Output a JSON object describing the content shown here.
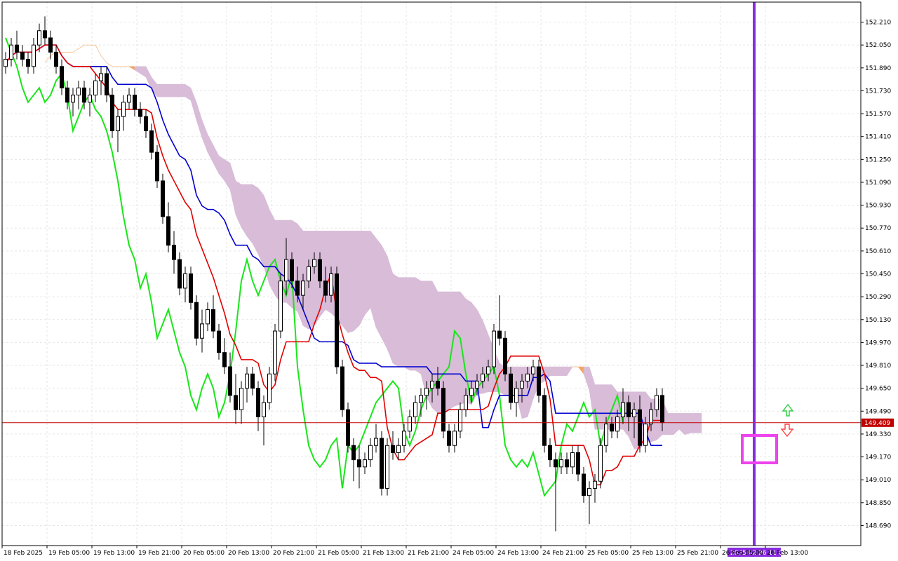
{
  "chart_data": {
    "type": "candlestick",
    "indicator": "Ichimoku Kinko Hyo",
    "grid": true,
    "y_range": [
      148.55,
      152.35
    ],
    "y_ticks": [
      "152.210",
      "152.050",
      "151.890",
      "151.730",
      "151.570",
      "151.410",
      "151.250",
      "151.090",
      "150.930",
      "150.770",
      "150.610",
      "150.450",
      "150.290",
      "150.130",
      "149.970",
      "149.810",
      "149.650",
      "149.490",
      "149.330",
      "149.170",
      "149.010",
      "148.850",
      "148.690"
    ],
    "x_ticks": [
      "18 Feb 2025",
      "19 Feb 05:00",
      "19 Feb 13:00",
      "19 Feb 21:00",
      "20 Feb 05:00",
      "20 Feb 13:00",
      "20 Feb 21:00",
      "21 Feb 05:00",
      "21 Feb 13:00",
      "21 Feb 21:00",
      "24 Feb 05:00",
      "24 Feb 13:00",
      "24 Feb 21:00",
      "25 Feb 05:00",
      "25 Feb 13:00",
      "25 Feb 21:00",
      "26 Feb 05:00",
      "26 Feb 13:00"
    ],
    "current_price": "149.409",
    "cursor_time_label": "2025.02.26 11:00",
    "colors": {
      "bull_candle": "#000000",
      "bear_candle": "#000000",
      "tenkan_sen": "#e00000",
      "kijun_sen": "#0000d0",
      "chikou_span": "#19e619",
      "kumo_bearish": "#d8bcd8",
      "kumo_bullish": "#f4a460",
      "price_line": "#c00000",
      "cursor_line": "#8a2be2",
      "highlight_box": "#ee44ee",
      "arrow_up": "#2ecc40",
      "arrow_down": "#ff4040"
    },
    "candles_ohlc": [
      [
        151.9,
        152.0,
        151.85,
        151.95
      ],
      [
        151.95,
        152.1,
        151.9,
        152.05
      ],
      [
        152.05,
        152.15,
        151.95,
        152.0
      ],
      [
        152.0,
        152.05,
        151.9,
        151.95
      ],
      [
        151.95,
        152.0,
        151.85,
        151.9
      ],
      [
        151.9,
        152.1,
        151.85,
        152.05
      ],
      [
        152.05,
        152.2,
        152.0,
        152.15
      ],
      [
        152.15,
        152.25,
        152.05,
        152.1
      ],
      [
        152.1,
        152.15,
        151.95,
        152.0
      ],
      [
        152.0,
        152.05,
        151.85,
        151.9
      ],
      [
        151.9,
        151.95,
        151.7,
        151.75
      ],
      [
        151.75,
        151.8,
        151.6,
        151.65
      ],
      [
        151.65,
        151.75,
        151.55,
        151.7
      ],
      [
        151.7,
        151.8,
        151.6,
        151.75
      ],
      [
        151.75,
        151.8,
        151.6,
        151.65
      ],
      [
        151.65,
        151.75,
        151.55,
        151.7
      ],
      [
        151.7,
        151.85,
        151.65,
        151.8
      ],
      [
        151.8,
        151.9,
        151.7,
        151.85
      ],
      [
        151.85,
        151.9,
        151.65,
        151.7
      ],
      [
        151.7,
        151.75,
        151.4,
        151.45
      ],
      [
        151.45,
        151.6,
        151.3,
        151.55
      ],
      [
        151.55,
        151.7,
        151.45,
        151.65
      ],
      [
        151.65,
        151.75,
        151.6,
        151.7
      ],
      [
        151.7,
        151.75,
        151.55,
        151.6
      ],
      [
        151.6,
        151.65,
        151.5,
        151.55
      ],
      [
        151.55,
        151.6,
        151.4,
        151.45
      ],
      [
        151.45,
        151.5,
        151.25,
        151.3
      ],
      [
        151.3,
        151.35,
        151.05,
        151.1
      ],
      [
        151.1,
        151.15,
        150.8,
        150.85
      ],
      [
        150.85,
        150.95,
        150.6,
        150.65
      ],
      [
        150.65,
        150.75,
        150.45,
        150.55
      ],
      [
        150.55,
        150.6,
        150.3,
        150.35
      ],
      [
        150.35,
        150.5,
        150.25,
        150.45
      ],
      [
        150.45,
        150.5,
        150.2,
        150.25
      ],
      [
        150.25,
        150.3,
        149.95,
        150.0
      ],
      [
        150.0,
        150.2,
        149.9,
        150.1
      ],
      [
        150.1,
        150.25,
        150.05,
        150.2
      ],
      [
        150.2,
        150.3,
        150.0,
        150.05
      ],
      [
        150.05,
        150.1,
        149.85,
        149.9
      ],
      [
        149.9,
        150.0,
        149.75,
        149.8
      ],
      [
        149.8,
        149.9,
        149.55,
        149.6
      ],
      [
        149.6,
        149.75,
        149.4,
        149.5
      ],
      [
        149.5,
        149.7,
        149.4,
        149.65
      ],
      [
        149.65,
        149.8,
        149.55,
        149.75
      ],
      [
        149.75,
        149.8,
        149.6,
        149.65
      ],
      [
        149.65,
        149.7,
        149.35,
        149.45
      ],
      [
        149.45,
        149.6,
        149.25,
        149.55
      ],
      [
        149.55,
        149.8,
        149.5,
        149.75
      ],
      [
        149.75,
        150.1,
        149.7,
        150.05
      ],
      [
        150.05,
        150.45,
        150.0,
        150.4
      ],
      [
        150.4,
        150.7,
        150.3,
        150.55
      ],
      [
        150.55,
        150.6,
        150.35,
        150.4
      ],
      [
        150.4,
        150.5,
        150.25,
        150.3
      ],
      [
        150.3,
        150.45,
        150.2,
        150.4
      ],
      [
        150.4,
        150.55,
        150.35,
        150.5
      ],
      [
        150.5,
        150.6,
        150.45,
        150.55
      ],
      [
        150.55,
        150.6,
        150.35,
        150.4
      ],
      [
        150.4,
        150.5,
        150.25,
        150.3
      ],
      [
        150.3,
        150.5,
        150.25,
        150.45
      ],
      [
        150.45,
        150.5,
        149.75,
        149.8
      ],
      [
        149.8,
        149.85,
        149.45,
        149.5
      ],
      [
        149.5,
        149.55,
        149.2,
        149.25
      ],
      [
        149.25,
        149.3,
        149.0,
        149.15
      ],
      [
        149.15,
        149.25,
        148.95,
        149.1
      ],
      [
        149.1,
        149.2,
        149.05,
        149.15
      ],
      [
        149.15,
        149.3,
        149.1,
        149.25
      ],
      [
        149.25,
        149.4,
        149.2,
        149.3
      ],
      [
        149.3,
        149.35,
        148.9,
        148.95
      ],
      [
        148.95,
        149.3,
        148.9,
        149.25
      ],
      [
        149.25,
        149.35,
        149.15,
        149.2
      ],
      [
        149.2,
        149.3,
        149.15,
        149.25
      ],
      [
        149.25,
        149.4,
        149.2,
        149.35
      ],
      [
        149.35,
        149.5,
        149.3,
        149.45
      ],
      [
        149.45,
        149.6,
        149.4,
        149.55
      ],
      [
        149.55,
        149.65,
        149.45,
        149.6
      ],
      [
        149.6,
        149.7,
        149.5,
        149.65
      ],
      [
        149.65,
        149.75,
        149.55,
        149.7
      ],
      [
        149.7,
        149.8,
        149.6,
        149.65
      ],
      [
        149.65,
        149.7,
        149.3,
        149.35
      ],
      [
        149.35,
        149.4,
        149.2,
        149.25
      ],
      [
        149.25,
        149.4,
        149.2,
        149.35
      ],
      [
        149.35,
        149.55,
        149.3,
        149.5
      ],
      [
        149.5,
        149.65,
        149.45,
        149.6
      ],
      [
        149.6,
        149.7,
        149.55,
        149.65
      ],
      [
        149.65,
        149.75,
        149.6,
        149.7
      ],
      [
        149.7,
        149.8,
        149.65,
        149.75
      ],
      [
        149.75,
        149.85,
        149.7,
        149.8
      ],
      [
        149.8,
        150.1,
        149.75,
        150.05
      ],
      [
        150.05,
        150.3,
        149.95,
        150.0
      ],
      [
        150.0,
        150.05,
        149.7,
        149.75
      ],
      [
        149.75,
        149.8,
        149.5,
        149.55
      ],
      [
        149.55,
        149.7,
        149.45,
        149.65
      ],
      [
        149.65,
        149.75,
        149.55,
        149.7
      ],
      [
        149.7,
        149.8,
        149.65,
        149.75
      ],
      [
        149.75,
        149.85,
        149.7,
        149.8
      ],
      [
        149.8,
        149.85,
        149.55,
        149.6
      ],
      [
        149.6,
        149.65,
        149.2,
        149.25
      ],
      [
        149.25,
        149.3,
        149.1,
        149.15
      ],
      [
        149.15,
        149.2,
        148.65,
        149.1
      ],
      [
        149.1,
        149.2,
        149.05,
        149.15
      ],
      [
        149.15,
        149.2,
        149.05,
        149.1
      ],
      [
        149.1,
        149.25,
        149.05,
        149.2
      ],
      [
        149.2,
        149.25,
        149.0,
        149.05
      ],
      [
        149.05,
        149.1,
        148.85,
        148.9
      ],
      [
        148.9,
        149.0,
        148.7,
        148.95
      ],
      [
        148.95,
        149.05,
        148.85,
        149.0
      ],
      [
        149.0,
        149.3,
        148.95,
        149.25
      ],
      [
        149.25,
        149.45,
        149.2,
        149.4
      ],
      [
        149.4,
        149.45,
        149.3,
        149.35
      ],
      [
        149.35,
        149.5,
        149.3,
        149.45
      ],
      [
        149.45,
        149.65,
        149.4,
        149.55
      ],
      [
        149.55,
        149.6,
        149.35,
        149.45
      ],
      [
        149.45,
        149.55,
        149.3,
        149.5
      ],
      [
        149.5,
        149.6,
        149.2,
        149.25
      ],
      [
        149.25,
        149.45,
        149.2,
        149.4
      ],
      [
        149.4,
        149.55,
        149.35,
        149.5
      ],
      [
        149.5,
        149.65,
        149.45,
        149.6
      ],
      [
        149.6,
        149.65,
        149.35,
        149.41
      ]
    ]
  }
}
